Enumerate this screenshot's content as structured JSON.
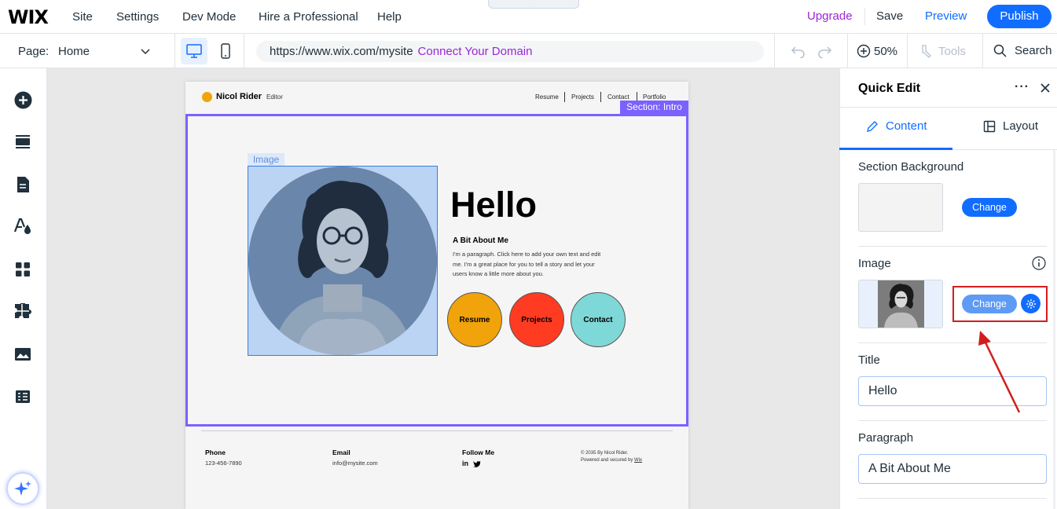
{
  "topbar": {
    "logo": "WIX",
    "menu": [
      "Site",
      "Settings",
      "Dev Mode",
      "Hire a Professional",
      "Help"
    ],
    "collapse_glyph": "⌃",
    "upgrade": "Upgrade",
    "save": "Save",
    "preview": "Preview",
    "publish": "Publish"
  },
  "toolbar": {
    "page_label": "Page:",
    "page_value": "Home",
    "url": "https://www.wix.com/mysite",
    "connect_domain": "Connect Your Domain",
    "zoom": "50%",
    "tools": "Tools",
    "search": "Search"
  },
  "rail": {
    "icons": [
      "add-icon",
      "sections-icon",
      "pages-icon",
      "design-icon",
      "apps-icon",
      "puzzle-icon",
      "media-icon",
      "table-icon"
    ]
  },
  "site": {
    "name": "Nicol Rider",
    "role": "Editor",
    "nav": [
      "Resume",
      "Projects",
      "Contact",
      "Portfolio"
    ],
    "section_tag": "Section: Intro",
    "image_tag": "Image",
    "hello": "Hello",
    "about_title": "A Bit About Me",
    "about_text": "I'm a paragraph. Click here to add your own text and edit me. I'm a great place for you to tell a story and let your users know a little more about you.",
    "buttons": [
      {
        "label": "Resume",
        "color": "#f0a30a"
      },
      {
        "label": "Projects",
        "color": "#ff3b22"
      },
      {
        "label": "Contact",
        "color": "#7fd8d8"
      }
    ],
    "footer": {
      "phone_label": "Phone",
      "phone": "123-456-7890",
      "email_label": "Email",
      "email": "info@mysite.com",
      "follow_label": "Follow Me",
      "social": "in",
      "copyright": "© 2035 By Nicol Rider.",
      "powered": "Powered and secured by",
      "powered_link": "Wix"
    }
  },
  "panel": {
    "title": "Quick Edit",
    "more": "···",
    "tabs": [
      "Content",
      "Layout"
    ],
    "section_background": "Section Background",
    "change": "Change",
    "image_label": "Image",
    "title_label": "Title",
    "title_value": "Hello",
    "paragraph_label": "Paragraph",
    "paragraph_value": "A Bit About Me"
  },
  "colors": {
    "accent": "#116dff",
    "section": "#7b61ff",
    "highlight": "#d31d1d",
    "upgrade": "#9a27d5"
  }
}
